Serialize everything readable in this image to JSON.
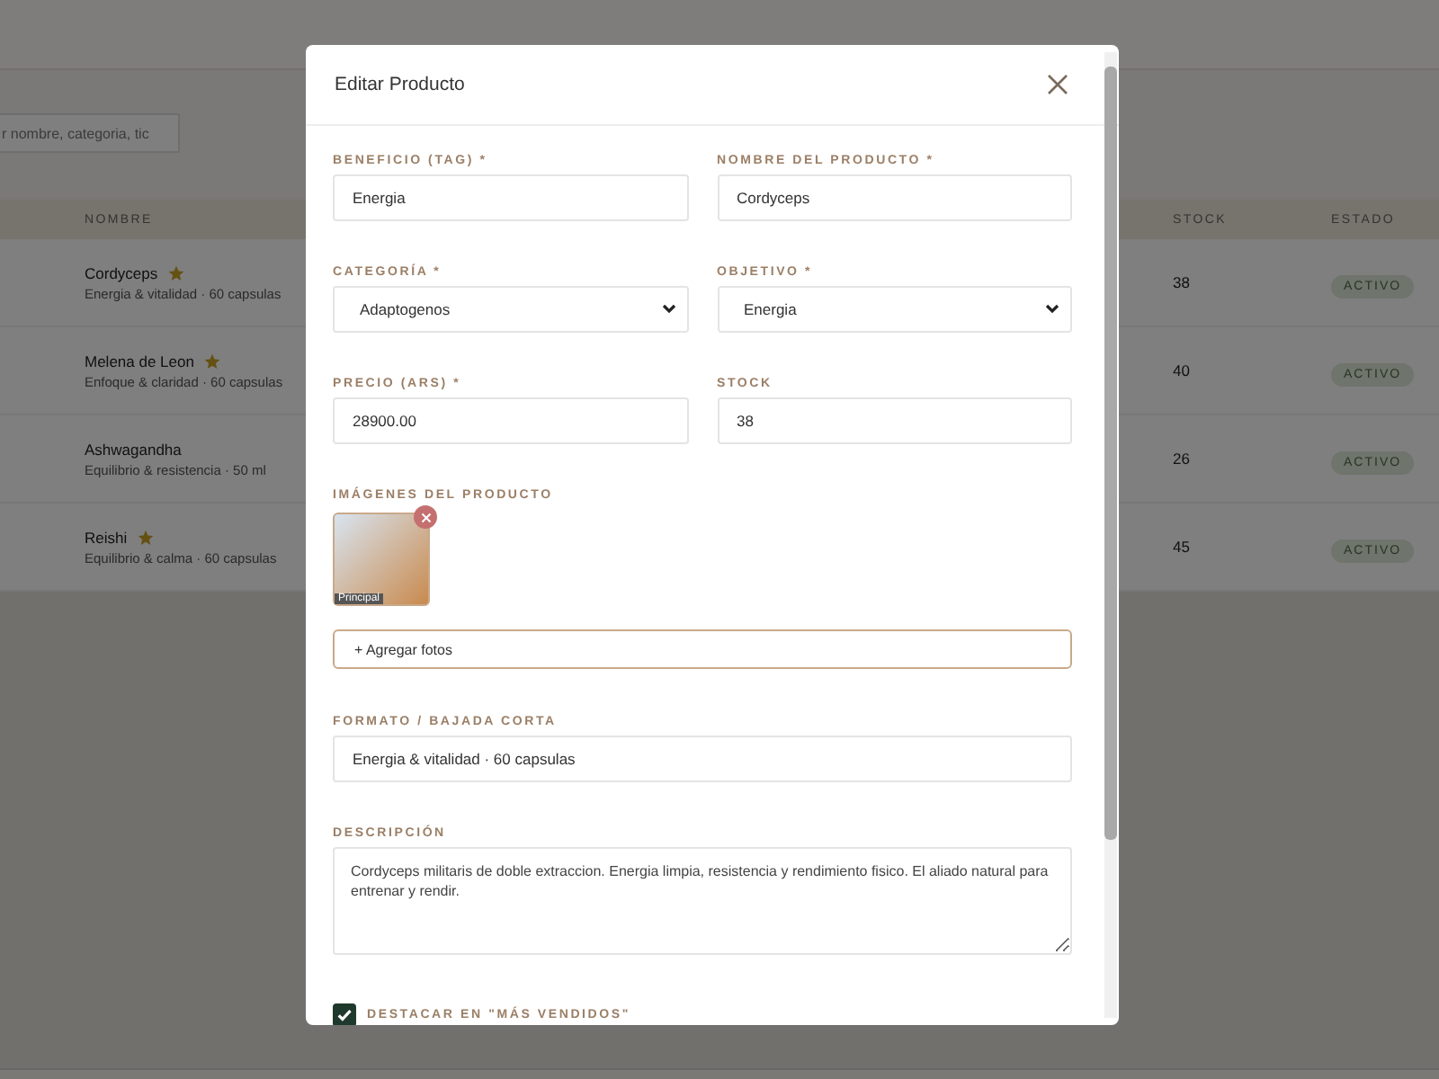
{
  "search": {
    "placeholder": "r nombre, categoria, tic"
  },
  "table": {
    "columns": [
      "NOMBRE",
      "STOCK",
      "ESTADO"
    ],
    "rows": [
      {
        "name": "Cordyceps",
        "featured": true,
        "subtitle": "Energia & vitalidad · 60 capsulas",
        "stock": "38",
        "status": "ACTIVO"
      },
      {
        "name": "Melena de Leon",
        "featured": true,
        "subtitle": "Enfoque & claridad · 60 capsulas",
        "stock": "40",
        "status": "ACTIVO"
      },
      {
        "name": "Ashwagandha",
        "featured": false,
        "subtitle": "Equilibrio & resistencia · 50 ml",
        "stock": "26",
        "status": "ACTIVO"
      },
      {
        "name": "Reishi",
        "featured": true,
        "subtitle": "Equilibrio & calma · 60 capsulas",
        "stock": "45",
        "status": "ACTIVO"
      }
    ]
  },
  "modal": {
    "title": "Editar Producto",
    "fields": [
      {
        "kind": "input",
        "label": "BENEFICIO (TAG) *",
        "value": "Energia"
      },
      {
        "kind": "input",
        "label": "NOMBRE DEL PRODUCTO *",
        "value": "Cordyceps"
      },
      {
        "kind": "select",
        "label": "CATEGORÍA *",
        "value": "Adaptogenos"
      },
      {
        "kind": "select",
        "label": "OBJETIVO *",
        "value": "Energia"
      },
      {
        "kind": "input",
        "label": "PRECIO (ARS) *",
        "value": "28900.00"
      },
      {
        "kind": "input",
        "label": "STOCK",
        "value": "38"
      }
    ],
    "images": {
      "label": "IMÁGENES DEL PRODUCTO",
      "items": [
        {
          "badge": "Principal"
        }
      ],
      "add_button": "+ Agregar fotos"
    },
    "format": {
      "label": "FORMATO / BAJADA CORTA",
      "value": "Energia & vitalidad · 60 capsulas"
    },
    "description": {
      "label": "DESCRIPCIÓN",
      "value": "Cordyceps militaris de doble extraccion. Energia limpia, resistencia y rendimiento fisico. El aliado natural para entrenar y rendir."
    },
    "bestseller": {
      "label": "DESTACAR EN \"MÁS VENDIDOS\"",
      "checked": true
    }
  }
}
